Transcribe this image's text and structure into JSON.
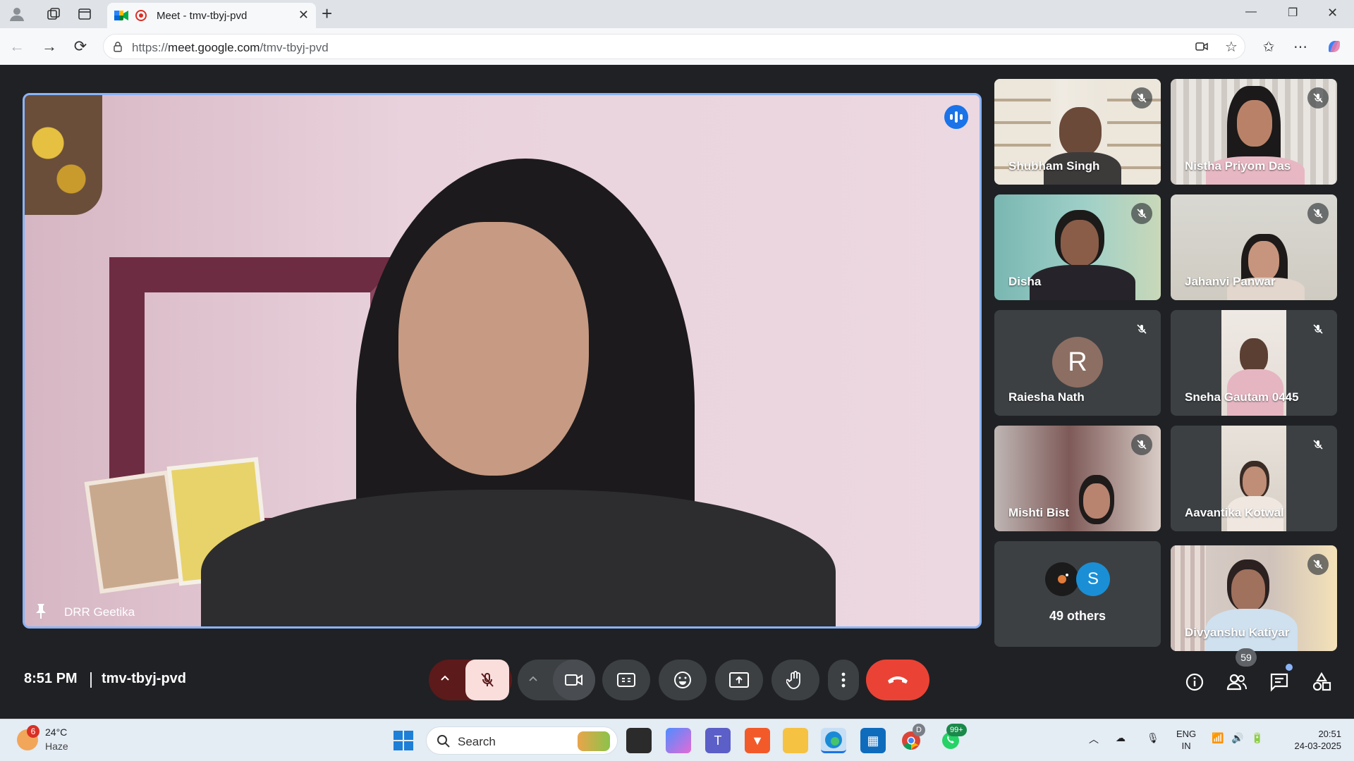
{
  "browser": {
    "tab_title": "Meet - tmv-tbyj-pvd",
    "url_prefix": "https://",
    "url_host": "meet.google.com",
    "url_path": "/tmv-tbyj-pvd"
  },
  "meet": {
    "main_speaker": "DRR Geetika",
    "participants": [
      {
        "name": "Shubham Singh",
        "muted": true
      },
      {
        "name": "Nistha Priyom Das",
        "muted": true
      },
      {
        "name": "Disha",
        "muted": true
      },
      {
        "name": "Jahanvi Panwar",
        "muted": true
      },
      {
        "name": "Raiesha Nath",
        "muted": true,
        "avatar_letter": "R"
      },
      {
        "name": "Sneha Gautam 0445",
        "muted": true
      },
      {
        "name": "Mishti Bist",
        "muted": true
      },
      {
        "name": "Aavantika Kotwal",
        "muted": true
      },
      {
        "name": "Divyanshu Katiyar",
        "muted": true
      }
    ],
    "others": {
      "label": "49 others",
      "avatar_letter": "S"
    },
    "time": "8:51 PM",
    "meeting_code": "tmv-tbyj-pvd",
    "people_count": "59"
  },
  "taskbar": {
    "weather_temp": "24°C",
    "weather_cond": "Haze",
    "weather_badge": "6",
    "search_label": "Search",
    "lang_1": "ENG",
    "lang_2": "IN",
    "clock_time": "20:51",
    "clock_date": "24-03-2025",
    "chrome_badge": "D",
    "whatsapp_badge": "99+"
  },
  "colors": {
    "accent": "#8ab4f8",
    "end_call": "#ea4335",
    "mic_off": "#f9dedc"
  }
}
